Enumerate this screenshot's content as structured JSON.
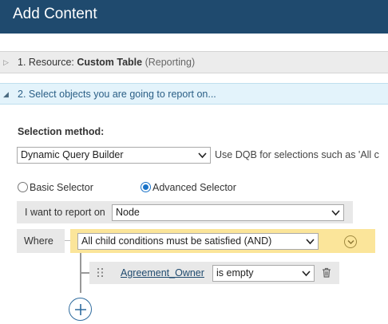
{
  "window": {
    "title": "Add Content"
  },
  "sections": [
    {
      "number_label": "1. Resource:",
      "name": "Custom Table",
      "qualifier": "(Reporting)",
      "state": "collapsed"
    },
    {
      "label": "2. Select objects you are going to report on...",
      "state": "expanded"
    }
  ],
  "selection": {
    "method_label": "Selection method:",
    "method_value": "Dynamic Query Builder",
    "method_hint": "Use DQB for selections such as 'All c",
    "radios": {
      "basic": "Basic Selector",
      "advanced": "Advanced Selector",
      "selected": "advanced"
    }
  },
  "report_on": {
    "label": "I want to report on",
    "value": "Node"
  },
  "where": {
    "label": "Where",
    "condition_value": "All child conditions must be satisfied (AND)",
    "children": [
      {
        "field": "Agreement_Owner",
        "operator": "is empty"
      }
    ]
  },
  "colors": {
    "titlebar": "#1f4a6e",
    "section_active": "#e3f3fb",
    "condition_bar": "#fbe59a",
    "accent": "#1a73c8"
  },
  "icons": [
    "expand-arrow-icon",
    "collapse-arrow-icon",
    "dropdown-caret-icon",
    "chevron-down-circle-icon",
    "drag-handle-icon",
    "trash-icon",
    "add-circle-icon"
  ]
}
